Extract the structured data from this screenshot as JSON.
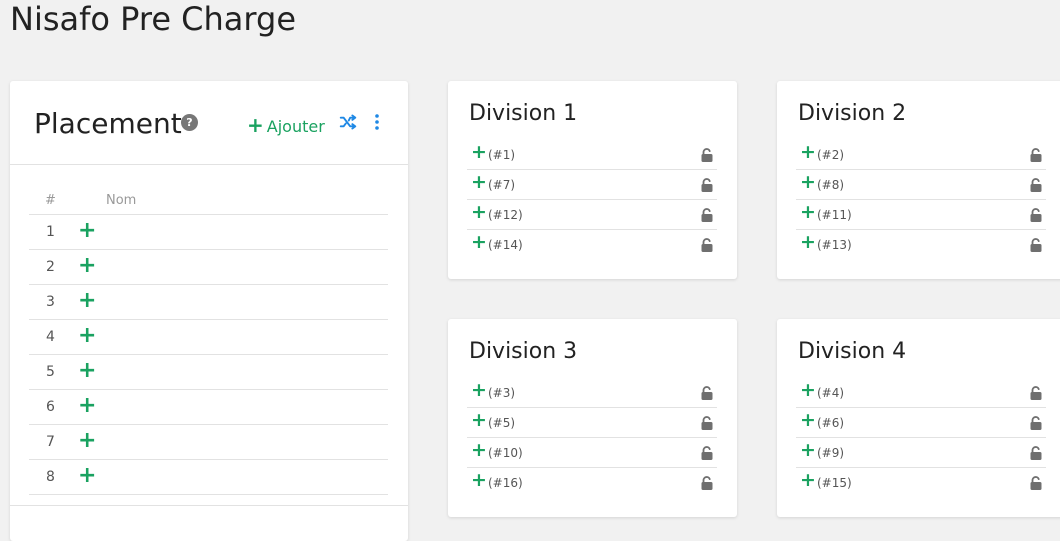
{
  "page": {
    "title": "Nisafo Pre Charge"
  },
  "placement": {
    "title": "Placement",
    "help_icon": "?",
    "add_label": "Ajouter",
    "add_icon": "+",
    "columns": [
      "#",
      "Nom"
    ],
    "rows": [
      {
        "num": "1"
      },
      {
        "num": "2"
      },
      {
        "num": "3"
      },
      {
        "num": "4"
      },
      {
        "num": "5"
      },
      {
        "num": "6"
      },
      {
        "num": "7"
      },
      {
        "num": "8"
      }
    ]
  },
  "divisions": [
    {
      "title": "Division 1",
      "seeds": [
        "(#1)",
        "(#7)",
        "(#12)",
        "(#14)"
      ]
    },
    {
      "title": "Division 2",
      "seeds": [
        "(#2)",
        "(#8)",
        "(#11)",
        "(#13)"
      ]
    },
    {
      "title": "Division 3",
      "seeds": [
        "(#3)",
        "(#5)",
        "(#10)",
        "(#16)"
      ]
    },
    {
      "title": "Division 4",
      "seeds": [
        "(#4)",
        "(#6)",
        "(#9)",
        "(#15)"
      ]
    }
  ],
  "icons": {
    "help": "help-icon",
    "add": "plus-icon",
    "shuffle": "shuffle-icon",
    "more": "more-vertical-icon",
    "lock": "unlock-icon"
  },
  "colors": {
    "accent_green": "#1aa260",
    "accent_blue": "#1e88e5",
    "icon_gray": "#6f6f6f"
  }
}
